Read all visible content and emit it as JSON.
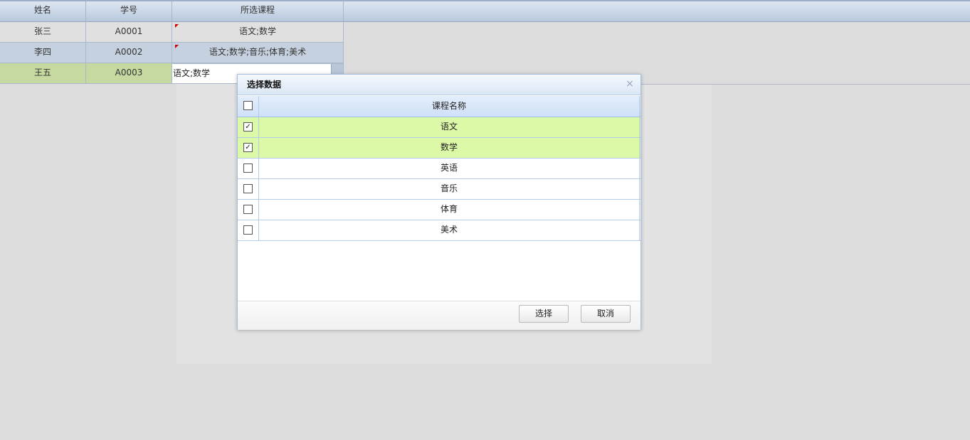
{
  "grid": {
    "columns": [
      "姓名",
      "学号",
      "所选课程"
    ],
    "rows": [
      {
        "name": "张三",
        "id": "A0001",
        "courses": "语文;数学"
      },
      {
        "name": "李四",
        "id": "A0002",
        "courses": "语文;数学;音乐;体育;美术"
      },
      {
        "name": "王五",
        "id": "A0003",
        "courses": "语文;数学"
      }
    ],
    "editor_value": "语文;数学"
  },
  "dialog": {
    "title": "选择数据",
    "close_glyph": "×",
    "column_header": "课程名称",
    "items": [
      {
        "label": "语文",
        "checked": true
      },
      {
        "label": "数学",
        "checked": true
      },
      {
        "label": "英语",
        "checked": false
      },
      {
        "label": "音乐",
        "checked": false
      },
      {
        "label": "体育",
        "checked": false
      },
      {
        "label": "美术",
        "checked": false
      }
    ],
    "select_button": "选择",
    "cancel_button": "取消"
  },
  "colors": {
    "checked_row": "#dcf9a8",
    "selected_grid_row": "#c6d9a1",
    "header_gradient_top": "#dde6f1",
    "dirty_marker": "#cc0000"
  }
}
